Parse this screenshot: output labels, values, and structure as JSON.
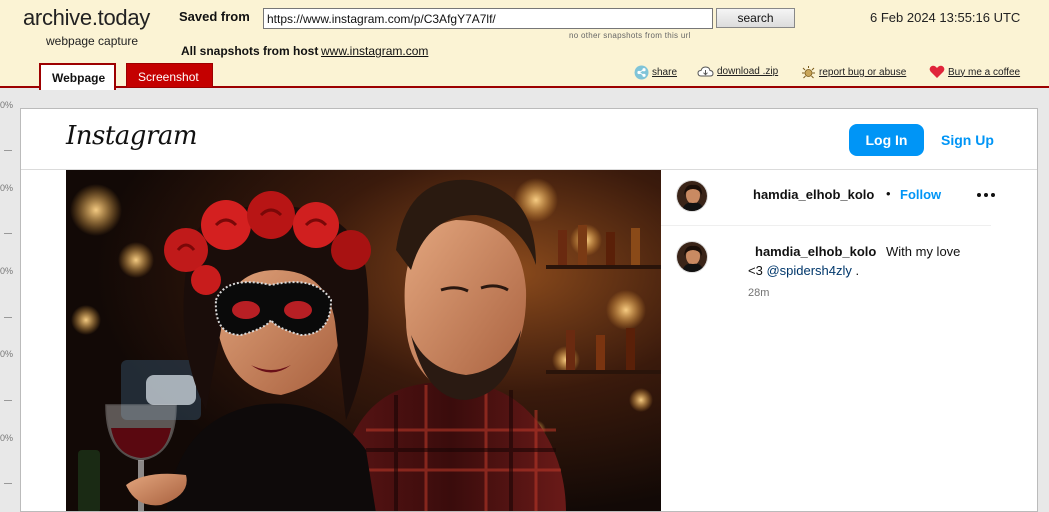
{
  "archive": {
    "logo": "archive.today",
    "subtitle": "webpage capture",
    "saved_from_label": "Saved from",
    "url_value": "https://www.instagram.com/p/C3AfgY7A7lf/",
    "search_label": "search",
    "no_other_snapshots": "no other snapshots from this url",
    "all_snapshots_label": "All snapshots  from host",
    "host": "www.instagram.com",
    "date": "6 Feb 2024 13:55:16 UTC",
    "tabs": [
      {
        "label": "Webpage",
        "active": true
      },
      {
        "label": "Screenshot",
        "active": false
      }
    ],
    "tools": {
      "share": "share",
      "download": "download .zip",
      "report": "report bug or abuse",
      "coffee": "Buy me a coffee"
    },
    "accent_color": "#9d0000"
  },
  "ruler": {
    "label": "0%"
  },
  "instagram": {
    "logo": "Instagram",
    "login_label": "Log In",
    "signup_label": "Sign Up",
    "post": {
      "username": "hamdia_elhob_kolo",
      "separator": "•",
      "follow_label": "Follow",
      "caption_username": "hamdia_elhob_kolo",
      "caption_text_1": "With my love",
      "caption_text_2": "<3",
      "mention": "@spidersh4zly",
      "caption_end": ".",
      "time": "28m"
    },
    "brand_color": "#0095f6"
  }
}
